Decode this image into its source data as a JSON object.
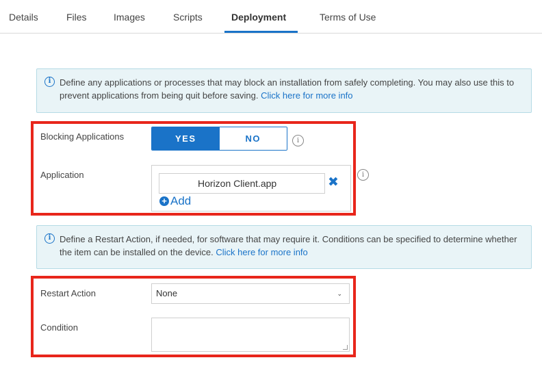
{
  "tabs": [
    {
      "label": "Details",
      "active": false
    },
    {
      "label": "Files",
      "active": false
    },
    {
      "label": "Images",
      "active": false
    },
    {
      "label": "Scripts",
      "active": false
    },
    {
      "label": "Deployment",
      "active": true
    },
    {
      "label": "Terms of Use",
      "active": false
    }
  ],
  "blocking_info": {
    "text": "Define any applications or processes that may block an installation from safely completing. You may also use this to prevent applications from being quit before saving.",
    "link": "Click here for more info",
    "icon": "info-icon"
  },
  "blocking_applications": {
    "label": "Blocking Applications",
    "yes_label": "YES",
    "no_label": "NO",
    "selected": "YES",
    "help_icon": "help-icon"
  },
  "application": {
    "label": "Application",
    "value": "Horizon Client.app",
    "add_label": "Add",
    "remove_icon": "close-icon",
    "help_icon": "help-icon"
  },
  "restart_info": {
    "text": "Define a Restart Action, if needed, for software that may require it. Conditions can be specified to determine whether the item can be installed on the device.",
    "link": "Click here for more info",
    "icon": "info-icon"
  },
  "restart_action": {
    "label": "Restart Action",
    "value": "None"
  },
  "condition": {
    "label": "Condition",
    "value": ""
  },
  "colors": {
    "accent": "#1a73c8",
    "highlight": "#e8261b",
    "info_bg": "#e9f4f7"
  }
}
